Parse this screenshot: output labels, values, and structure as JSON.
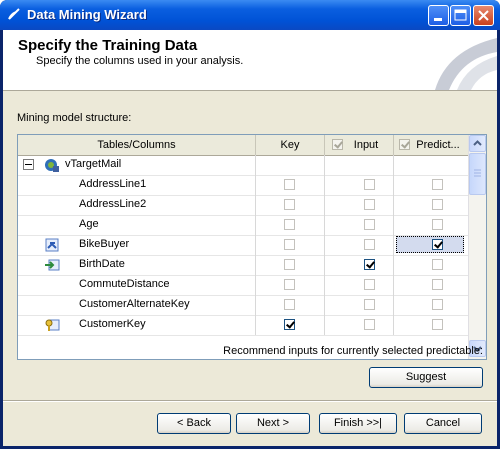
{
  "window": {
    "title": "Data Mining Wizard"
  },
  "header": {
    "title": "Specify the Training Data",
    "subtitle": "Specify the columns used in your analysis."
  },
  "structure_label": "Mining model structure:",
  "grid": {
    "columns": {
      "tables": "Tables/Columns",
      "key": "Key",
      "input": "Input",
      "predict": "Predict..."
    },
    "table_name": "vTargetMail",
    "rows": [
      {
        "name": "AddressLine1",
        "icon": "none",
        "key": false,
        "input": false,
        "predict": false
      },
      {
        "name": "AddressLine2",
        "icon": "none",
        "key": false,
        "input": false,
        "predict": false
      },
      {
        "name": "Age",
        "icon": "none",
        "key": false,
        "input": false,
        "predict": false
      },
      {
        "name": "BikeBuyer",
        "icon": "predict-column-icon",
        "key": false,
        "input": false,
        "predict": true
      },
      {
        "name": "BirthDate",
        "icon": "input-column-icon",
        "key": false,
        "input": true,
        "predict": false
      },
      {
        "name": "CommuteDistance",
        "icon": "none",
        "key": false,
        "input": false,
        "predict": false
      },
      {
        "name": "CustomerAlternateKey",
        "icon": "none",
        "key": false,
        "input": false,
        "predict": false
      },
      {
        "name": "CustomerKey",
        "icon": "key-column-icon",
        "key": true,
        "input": false,
        "predict": false
      }
    ]
  },
  "recommend_label": "Recommend inputs for currently selected predictable:",
  "buttons": {
    "suggest": "Suggest",
    "back": "< Back",
    "next": "Next >",
    "finish": "Finish >>|",
    "cancel": "Cancel"
  },
  "colors": {
    "titlebar": "#0a5fe0",
    "dialog": "#ece9d8",
    "selection": "#d3dbee"
  }
}
